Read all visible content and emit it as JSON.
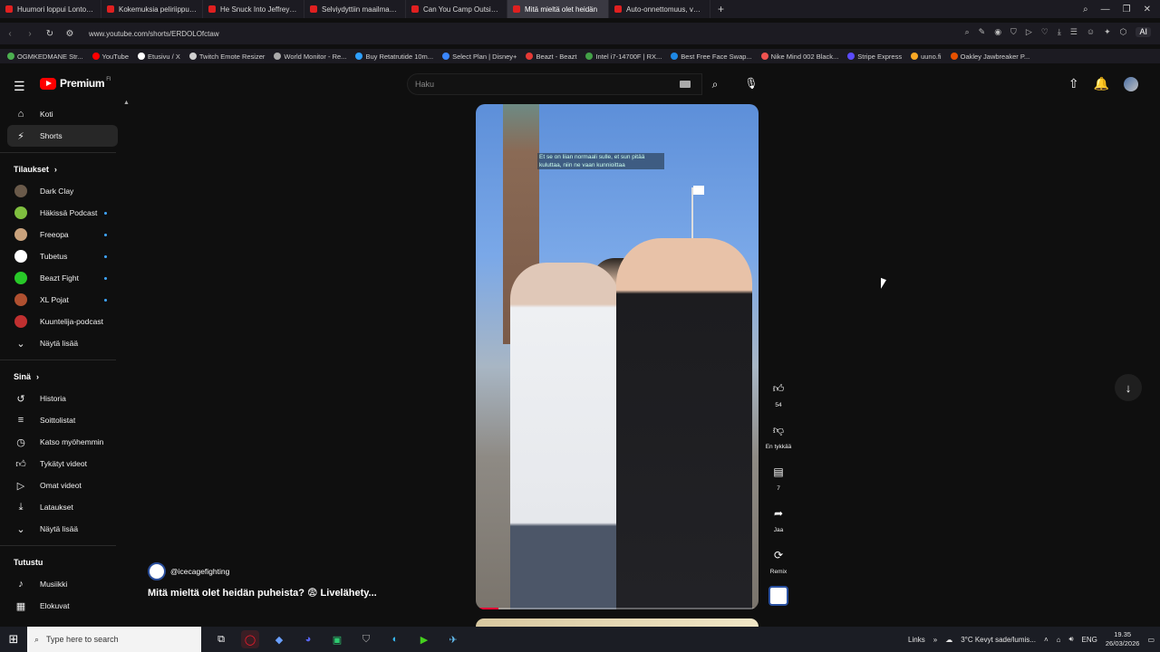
{
  "browser": {
    "tabs": [
      {
        "label": "Huumori loppui Lontoossa",
        "color": "#e02020"
      },
      {
        "label": "Kokemuksia peliriippuvuudesta",
        "color": "#e02020"
      },
      {
        "label": "He Snuck Into Jeffrey Epstein",
        "color": "#e02020"
      },
      {
        "label": "Selviydyttiin maailman vaaral",
        "color": "#e02020"
      },
      {
        "label": "Can You Camp Outside New",
        "color": "#e02020"
      },
      {
        "label": "Mitä mieltä olet heidän",
        "color": "#e02020",
        "active": true
      },
      {
        "label": "Auto-onnettomuus, vastaa",
        "color": "#e02020"
      }
    ],
    "url": "www.youtube.com/shorts/ERDOLOfctaw",
    "bookmarks": [
      "OGMKEDMANE Str...",
      "YouTube",
      "Etusivu / X",
      "Twitch Emote Resizer",
      "World Monitor - Re...",
      "Buy Retatrutide 10m...",
      "Select Plan | Disney+",
      "Beazt - Beazt",
      "Intel i7-14700F | RX...",
      "Best Free Face Swap...",
      "Nike Mind 002 Black...",
      "Stripe Express",
      "uuno.fi",
      "Oakley Jawbreaker P..."
    ],
    "ai_label": "AI"
  },
  "header": {
    "brand": "Premium",
    "brand_sup": "FI",
    "search_placeholder": "Haku"
  },
  "sidebar": {
    "main": [
      {
        "label": "Koti",
        "icon": "home-icon"
      },
      {
        "label": "Shorts",
        "icon": "shorts-icon",
        "active": true
      }
    ],
    "subs_heading": "Tilaukset",
    "subs": [
      {
        "label": "Dark Clay",
        "color": "#6a5a4a",
        "live": false
      },
      {
        "label": "Häkissä Podcast",
        "color": "#7fbf3f",
        "live": true
      },
      {
        "label": "Freeopa",
        "color": "#c9a27c",
        "live": true
      },
      {
        "label": "Tubetus",
        "color": "#ffffff",
        "live": true
      },
      {
        "label": "Beazt Fight",
        "color": "#28c828",
        "live": true
      },
      {
        "label": "XL Pojat",
        "color": "#b05030",
        "live": true
      },
      {
        "label": "Kuuntelija-podcast",
        "color": "#c03030",
        "live": false
      }
    ],
    "subs_more": "Näytä lisää",
    "you_heading": "Sinä",
    "you": [
      {
        "label": "Historia",
        "icon": "history-icon"
      },
      {
        "label": "Soittolistat",
        "icon": "playlist-icon"
      },
      {
        "label": "Katso myöhemmin",
        "icon": "clock-icon"
      },
      {
        "label": "Tykätyt videot",
        "icon": "thumbs-up-icon"
      },
      {
        "label": "Omat videot",
        "icon": "video-icon"
      },
      {
        "label": "Lataukset",
        "icon": "download-icon"
      }
    ],
    "you_more": "Näytä lisää",
    "explore_heading": "Tutustu",
    "explore": [
      {
        "label": "Musiikki",
        "icon": "music-icon"
      },
      {
        "label": "Elokuvat",
        "icon": "film-icon"
      }
    ]
  },
  "short": {
    "caption": "Et se on liian normaali sulle, et sun pitää kuluttaa, niin ne vaan kunnioittaa",
    "progress": 0.08,
    "channel": "@icecagefighting",
    "title": "Mitä mieltä olet heidän puheista? 😨 Livelähety...",
    "likes": "54",
    "dislike_label": "En tykkää",
    "comments": "7",
    "share_label": "Jaa",
    "remix_label": "Remix"
  },
  "taskbar": {
    "search_placeholder": "Type here to search",
    "links": "Links",
    "weather": "3°C Kevyt sade/lumis...",
    "lang": "ENG",
    "time": "19.35",
    "date": "26/03/2026"
  }
}
